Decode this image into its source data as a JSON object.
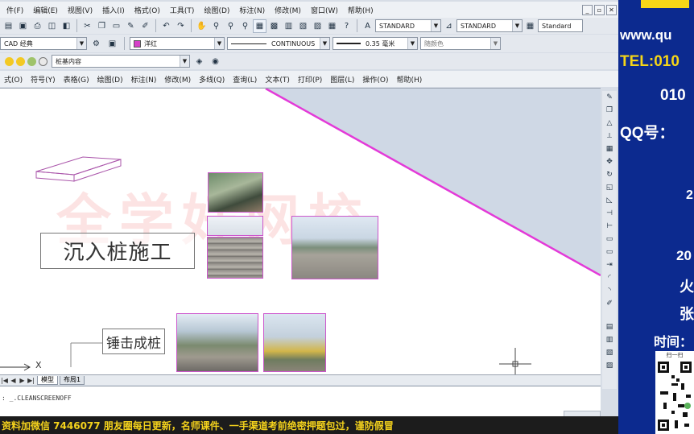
{
  "menubar": {
    "items": [
      "件(F)",
      "编辑(E)",
      "视图(V)",
      "插入(I)",
      "格式(O)",
      "工具(T)",
      "绘图(D)",
      "标注(N)",
      "修改(M)",
      "窗口(W)",
      "帮助(H)"
    ]
  },
  "toolbar1": {
    "textstyle": "STANDARD",
    "dimstyle": "STANDARD",
    "tablestyle": "Standard"
  },
  "toolbar2": {
    "workspace": "CAD 经典",
    "color": "洋红",
    "linetype": "CONTINUOUS",
    "lineweight": "0.35 毫米",
    "plotstyle": "随颜色"
  },
  "toolbar3": {
    "layer": "桩基内容"
  },
  "menu2": {
    "items": [
      "式(O)",
      "符号(Y)",
      "表格(G)",
      "绘图(D)",
      "标注(N)",
      "修改(M)",
      "多线(Q)",
      "查询(L)",
      "文本(T)",
      "打印(P)",
      "图层(L)",
      "操作(O)",
      "帮助(H)"
    ]
  },
  "drawing": {
    "watermark": "全学好网校",
    "label_sink_pile": "沉入桩施工",
    "label_hammer_pile": "锤击成桩",
    "ucs_x_label": "X"
  },
  "tabs": [
    "模型",
    "布局1"
  ],
  "command_line": ": _.CLEANSCREENOFF",
  "banner": "资料加微信 7446077 朋友圈每日更新，名师课件、一手渠道考前绝密押题包过，谨防假冒",
  "promo": {
    "l1": "www.qu",
    "l2": "TEL:010",
    "l3": "010",
    "l4": "QQ号：",
    "l5": "2",
    "l6": "20",
    "l7": "火",
    "l8": "张",
    "l9": "时间：",
    "qr_caption": "扫一扫"
  },
  "colors": {
    "magenta": "#e33ad8",
    "promo_bg": "#0c2a8f",
    "banner_text": "#f4d21c"
  }
}
